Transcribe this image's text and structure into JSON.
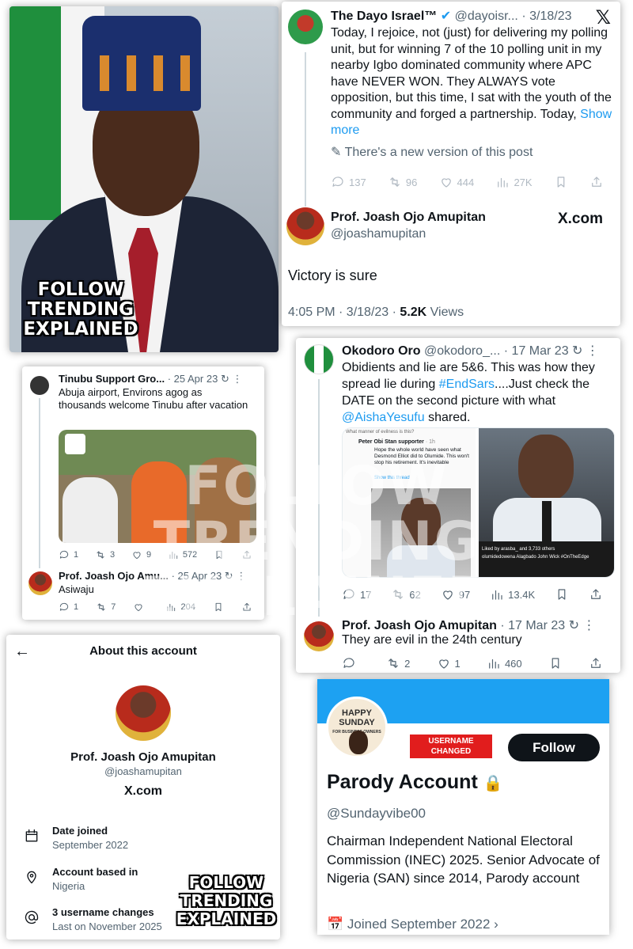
{
  "watermark": {
    "lines": [
      "FOLLOW",
      "TRENDING",
      "EXPLAINED"
    ]
  },
  "portrait": {
    "overlay_lines": [
      "FOLLOW",
      "TRENDING",
      "EXPLAINED"
    ]
  },
  "tweet_dayo": {
    "name": "The Dayo Israel™",
    "handle": "@dayoisr...",
    "date": "3/18/23",
    "body": "Today, I rejoice, not (just) for delivering my polling unit, but for winning 7 of the 10 polling unit in my nearby Igbo dominated community where APC have NEVER WON. They ALWAYS vote opposition, but this time, I sat with the youth of the community and forged a partnership. Today,",
    "show_more": "Show more",
    "edit_notice": "There's a new version of this post",
    "stats": {
      "replies": "137",
      "reposts": "96",
      "likes": "444",
      "views": "27K"
    },
    "reply_name": "Prof. Joash Ojo Amupitan",
    "reply_handle": "@joashamupitan",
    "xcom": "X.com",
    "reply_body": "Victory is sure",
    "time": "4:05 PM · 3/18/23 ·",
    "views_count": "5.2K",
    "views_label": "Views"
  },
  "tweet_tinubu": {
    "name": "Tinubu Support Gro...",
    "date": "25 Apr 23",
    "body": "Abuja airport, Environs agog as thousands welcome Tinubu after vacation",
    "stats": {
      "replies": "1",
      "reposts": "3",
      "likes": "9",
      "views": "572"
    },
    "reply_name": "Prof. Joash Ojo Amu...",
    "reply_date": "25 Apr 23",
    "reply_body": "Asiwaju",
    "reply_stats": {
      "replies": "1",
      "reposts": "7",
      "likes": "",
      "views": "204"
    }
  },
  "tweet_okodoro": {
    "name": "Okodoro Oro",
    "handle": "@okodoro_...",
    "date": "17 Mar 23",
    "body_pre": "Obidients and lie are 5&6. This was how they spread lie during",
    "hashtag": "#EndSars",
    "body_mid": "....Just check the DATE on the second picture with what",
    "mention": "@AishaYesufu",
    "body_post": "shared.",
    "embedded": {
      "top_text": "What manner of evilness is this?",
      "poster": "Peter Obi Stan supporter",
      "poster_time": "· 1h",
      "quote": "Hope the whole world have seen what Desmond Elliot did to Olumide. This won't stop his retirement. It's inevitable",
      "show_thread": "Show this thread",
      "liked_by": "Liked by arasba_ and 3,733 others",
      "caption": "olumidedowena Alagbado John Wick #OnTheEdge"
    },
    "stats": {
      "replies": "17",
      "reposts": "62",
      "likes": "97",
      "views": "13.4K"
    },
    "reply_name": "Prof. Joash Ojo Amupitan",
    "reply_date": "17 Mar 23",
    "reply_body": "They are evil in the 24th century",
    "reply_stats": {
      "replies": "",
      "reposts": "2",
      "likes": "1",
      "views": "460"
    }
  },
  "about": {
    "title": "About this account",
    "name": "Prof. Joash Ojo Amupitan",
    "handle": "@joashamupitan",
    "xcom": "X.com",
    "rows": [
      {
        "label": "Date joined",
        "value": "September 2022",
        "icon": "calendar-icon"
      },
      {
        "label": "Account based in",
        "value": "Nigeria",
        "icon": "location-icon"
      },
      {
        "label": "3 username changes",
        "value": "Last on November 2025",
        "icon": "at-icon"
      }
    ],
    "overlay_lines": [
      "FOLLOW",
      "TRENDING",
      "EXPLAINED"
    ]
  },
  "profile": {
    "avatar_text": [
      "HAPPY",
      "SUNDAY",
      "FOR BUSINESS OWNERS"
    ],
    "tag_lines": [
      "USERNAME",
      "CHANGED"
    ],
    "follow": "Follow",
    "name": "Parody Account",
    "handle": "@Sundayvibe00",
    "bio": "Chairman Independent National Electoral Commission (INEC) 2025. Senior Advocate of Nigeria (SAN) since 2014, Parody account",
    "joined": "Joined September 2022"
  }
}
